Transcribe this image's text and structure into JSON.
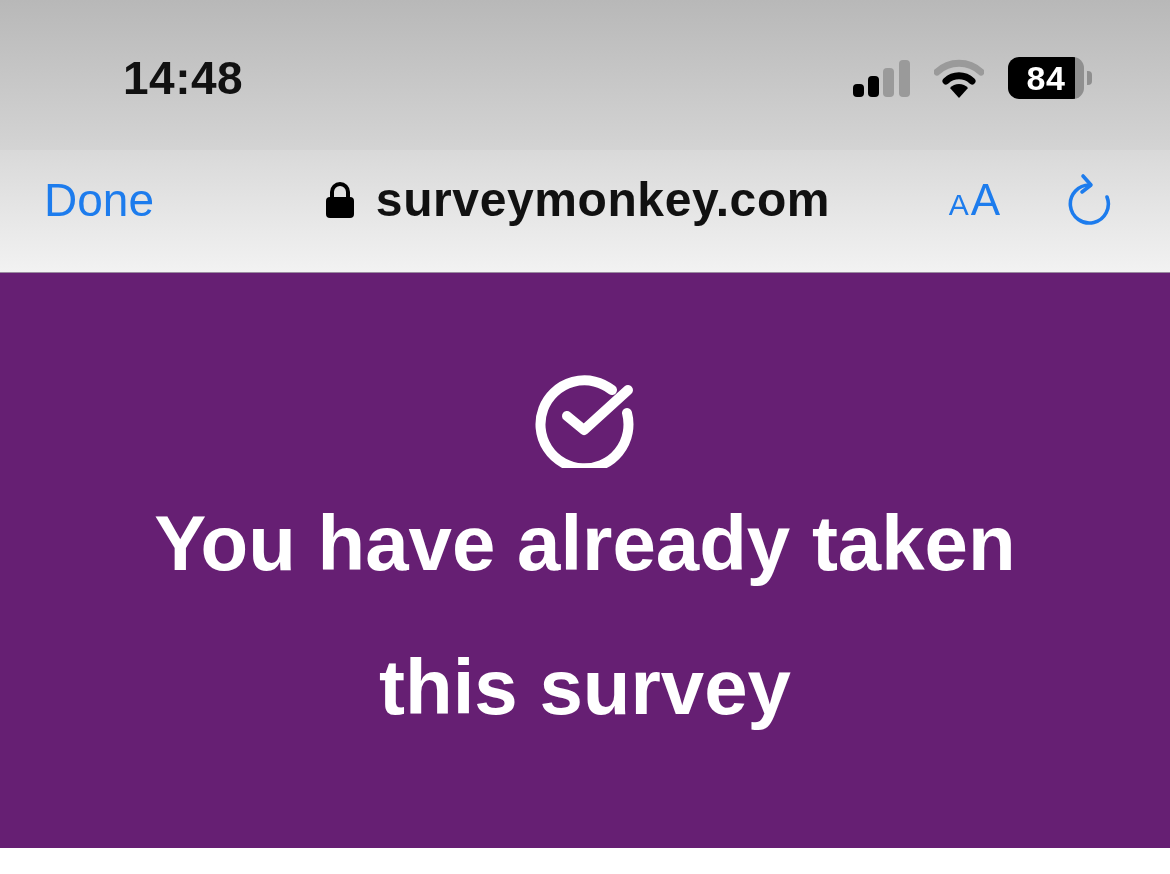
{
  "status_bar": {
    "time": "14:48",
    "battery": "84"
  },
  "browser_toolbar": {
    "done_button": "Done",
    "address": "surveymonkey.com",
    "text_size_button": {
      "small": "A",
      "large": "A"
    }
  },
  "banner": {
    "heading": "You have already taken this survey"
  }
}
